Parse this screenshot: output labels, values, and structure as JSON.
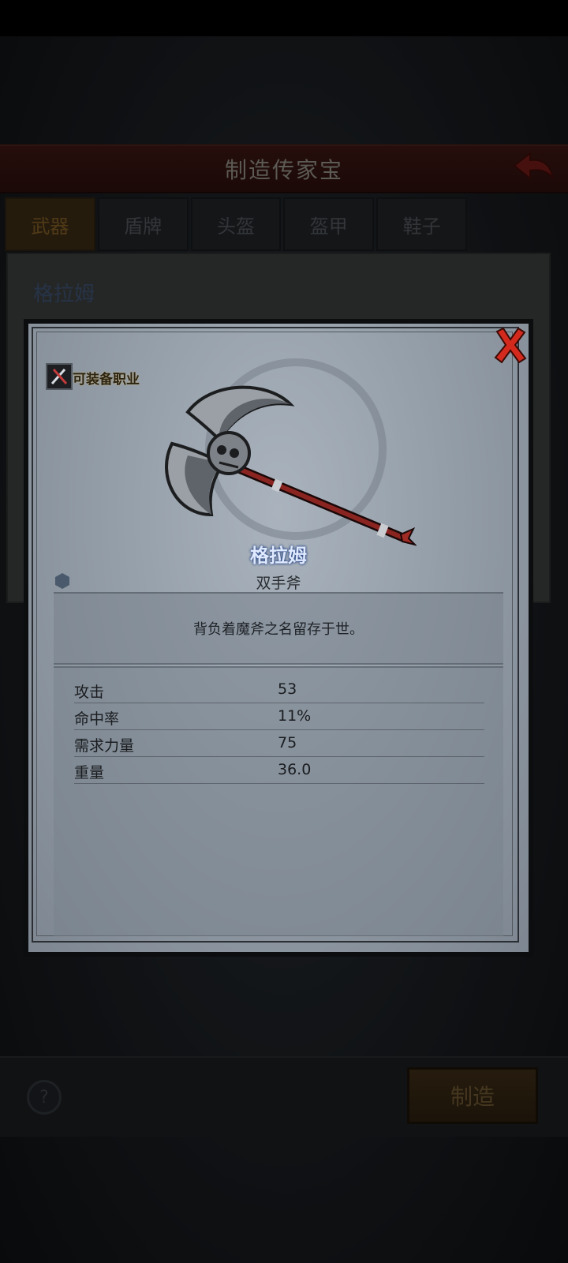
{
  "screen": {
    "title": "制造传家宝",
    "tabs": [
      {
        "label": "武器",
        "active": true
      },
      {
        "label": "盾牌",
        "active": false
      },
      {
        "label": "头盔",
        "active": false
      },
      {
        "label": "盔甲",
        "active": false
      },
      {
        "label": "鞋子",
        "active": false
      }
    ],
    "background_item_name": "格拉姆",
    "help_icon": "?",
    "make_button": "制造"
  },
  "modal": {
    "class_label": "可装备职业",
    "item_name": "格拉姆",
    "item_type": "双手斧",
    "description": "背负着魔斧之名留存于世。",
    "stats": [
      {
        "name": "攻击",
        "value": "53"
      },
      {
        "name": "命中率",
        "value": "11%"
      },
      {
        "name": "需求力量",
        "value": "75"
      },
      {
        "name": "重量",
        "value": "36.0"
      }
    ]
  },
  "colors": {
    "title_bar": "#3a1613",
    "close_red": "#d42a1e",
    "item_name_glow": "#2d4a86",
    "make_button": "#3b2b16"
  },
  "icons": {
    "back": "back-arrow-icon",
    "close": "close-x-icon",
    "class": "crossed-weapons-icon",
    "help": "question-icon"
  }
}
